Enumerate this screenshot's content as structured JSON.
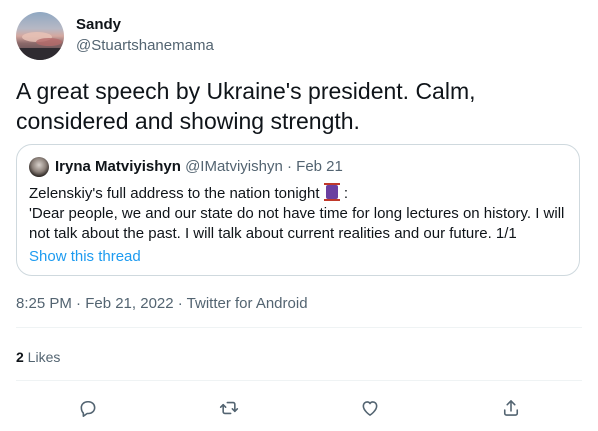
{
  "tweet": {
    "author_name": "Sandy",
    "author_handle": "@Stuartshanemama",
    "text": "A great speech by Ukraine's president. Calm, considered and showing strength.",
    "timestamp": "8:25 PM · Feb 21, 2022 · Twitter for Android",
    "likes_count": "2",
    "likes_label": " Likes"
  },
  "quote": {
    "name": "Iryna Matviyishyn",
    "handle": "@IMatviyishyn",
    "separator": " · ",
    "date": "Feb 21",
    "line1_before": "Zelenskiy's full address to the nation tonight ",
    "line1_after": " :",
    "body": "'Dear people, we and our state do not have time for long lectures on history. I will not talk about the past. I will talk about current realities and our future. 1/1",
    "show_thread": "Show this thread"
  },
  "colors": {
    "text": "#0f1419",
    "secondary": "#536471",
    "link": "#1d9bf0",
    "border": "#cfd9de",
    "divider": "#eff3f4"
  },
  "icons": {
    "reply": "speech-bubble-icon",
    "retweet": "retweet-arrows-icon",
    "like": "heart-icon",
    "share": "share-upload-icon",
    "emoji": "scroll-emoji-icon"
  }
}
